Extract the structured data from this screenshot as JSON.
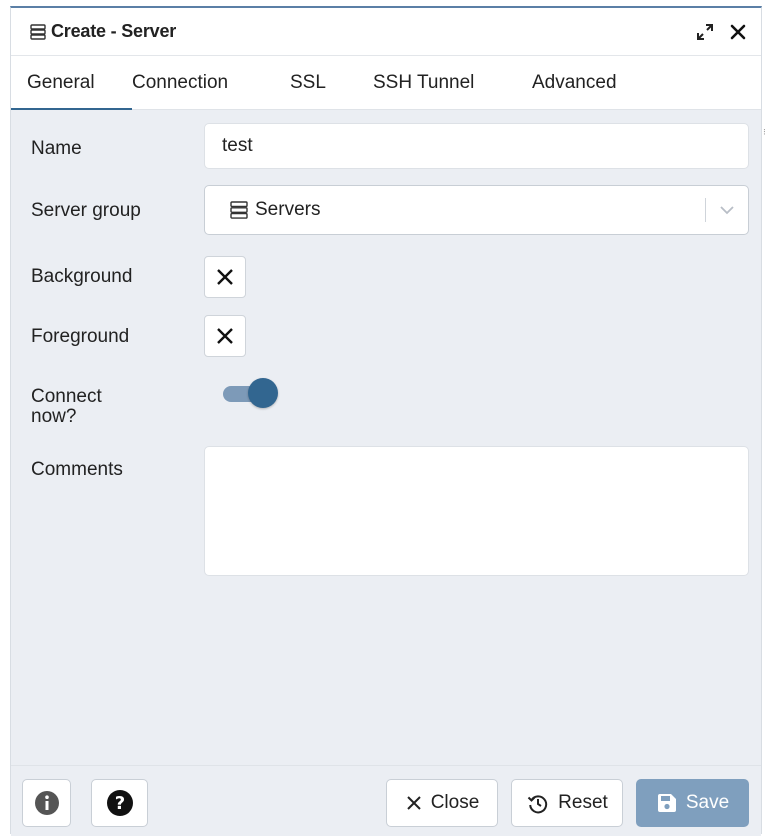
{
  "dialog": {
    "title": "Create - Server",
    "title_icon": "server-icon",
    "actions": {
      "maximize_icon": "maximize-icon",
      "close_icon": "close-icon"
    }
  },
  "tabs": [
    {
      "label": "General",
      "active": true
    },
    {
      "label": "Connection",
      "active": false
    },
    {
      "label": "SSL",
      "active": false
    },
    {
      "label": "SSH Tunnel",
      "active": false
    },
    {
      "label": "Advanced",
      "active": false
    }
  ],
  "form": {
    "name": {
      "label": "Name",
      "value": "test"
    },
    "server_group": {
      "label": "Server group",
      "value": "Servers",
      "icon": "server-icon"
    },
    "background": {
      "label": "Background",
      "icon": "x-icon"
    },
    "foreground": {
      "label": "Foreground",
      "icon": "x-icon"
    },
    "connect_now": {
      "label_line1": "Connect",
      "label_line2": "now?",
      "checked": true
    },
    "comments": {
      "label": "Comments",
      "value": ""
    }
  },
  "footer": {
    "info_icon": "info-icon",
    "help_icon": "help-icon",
    "close_label": "Close",
    "reset_label": "Reset",
    "save_label": "Save"
  },
  "colors": {
    "accent": "#326690",
    "toggle_track": "#7d9ab8",
    "save_bg": "#7f9fbe",
    "panel_bg": "#ebeef3"
  }
}
